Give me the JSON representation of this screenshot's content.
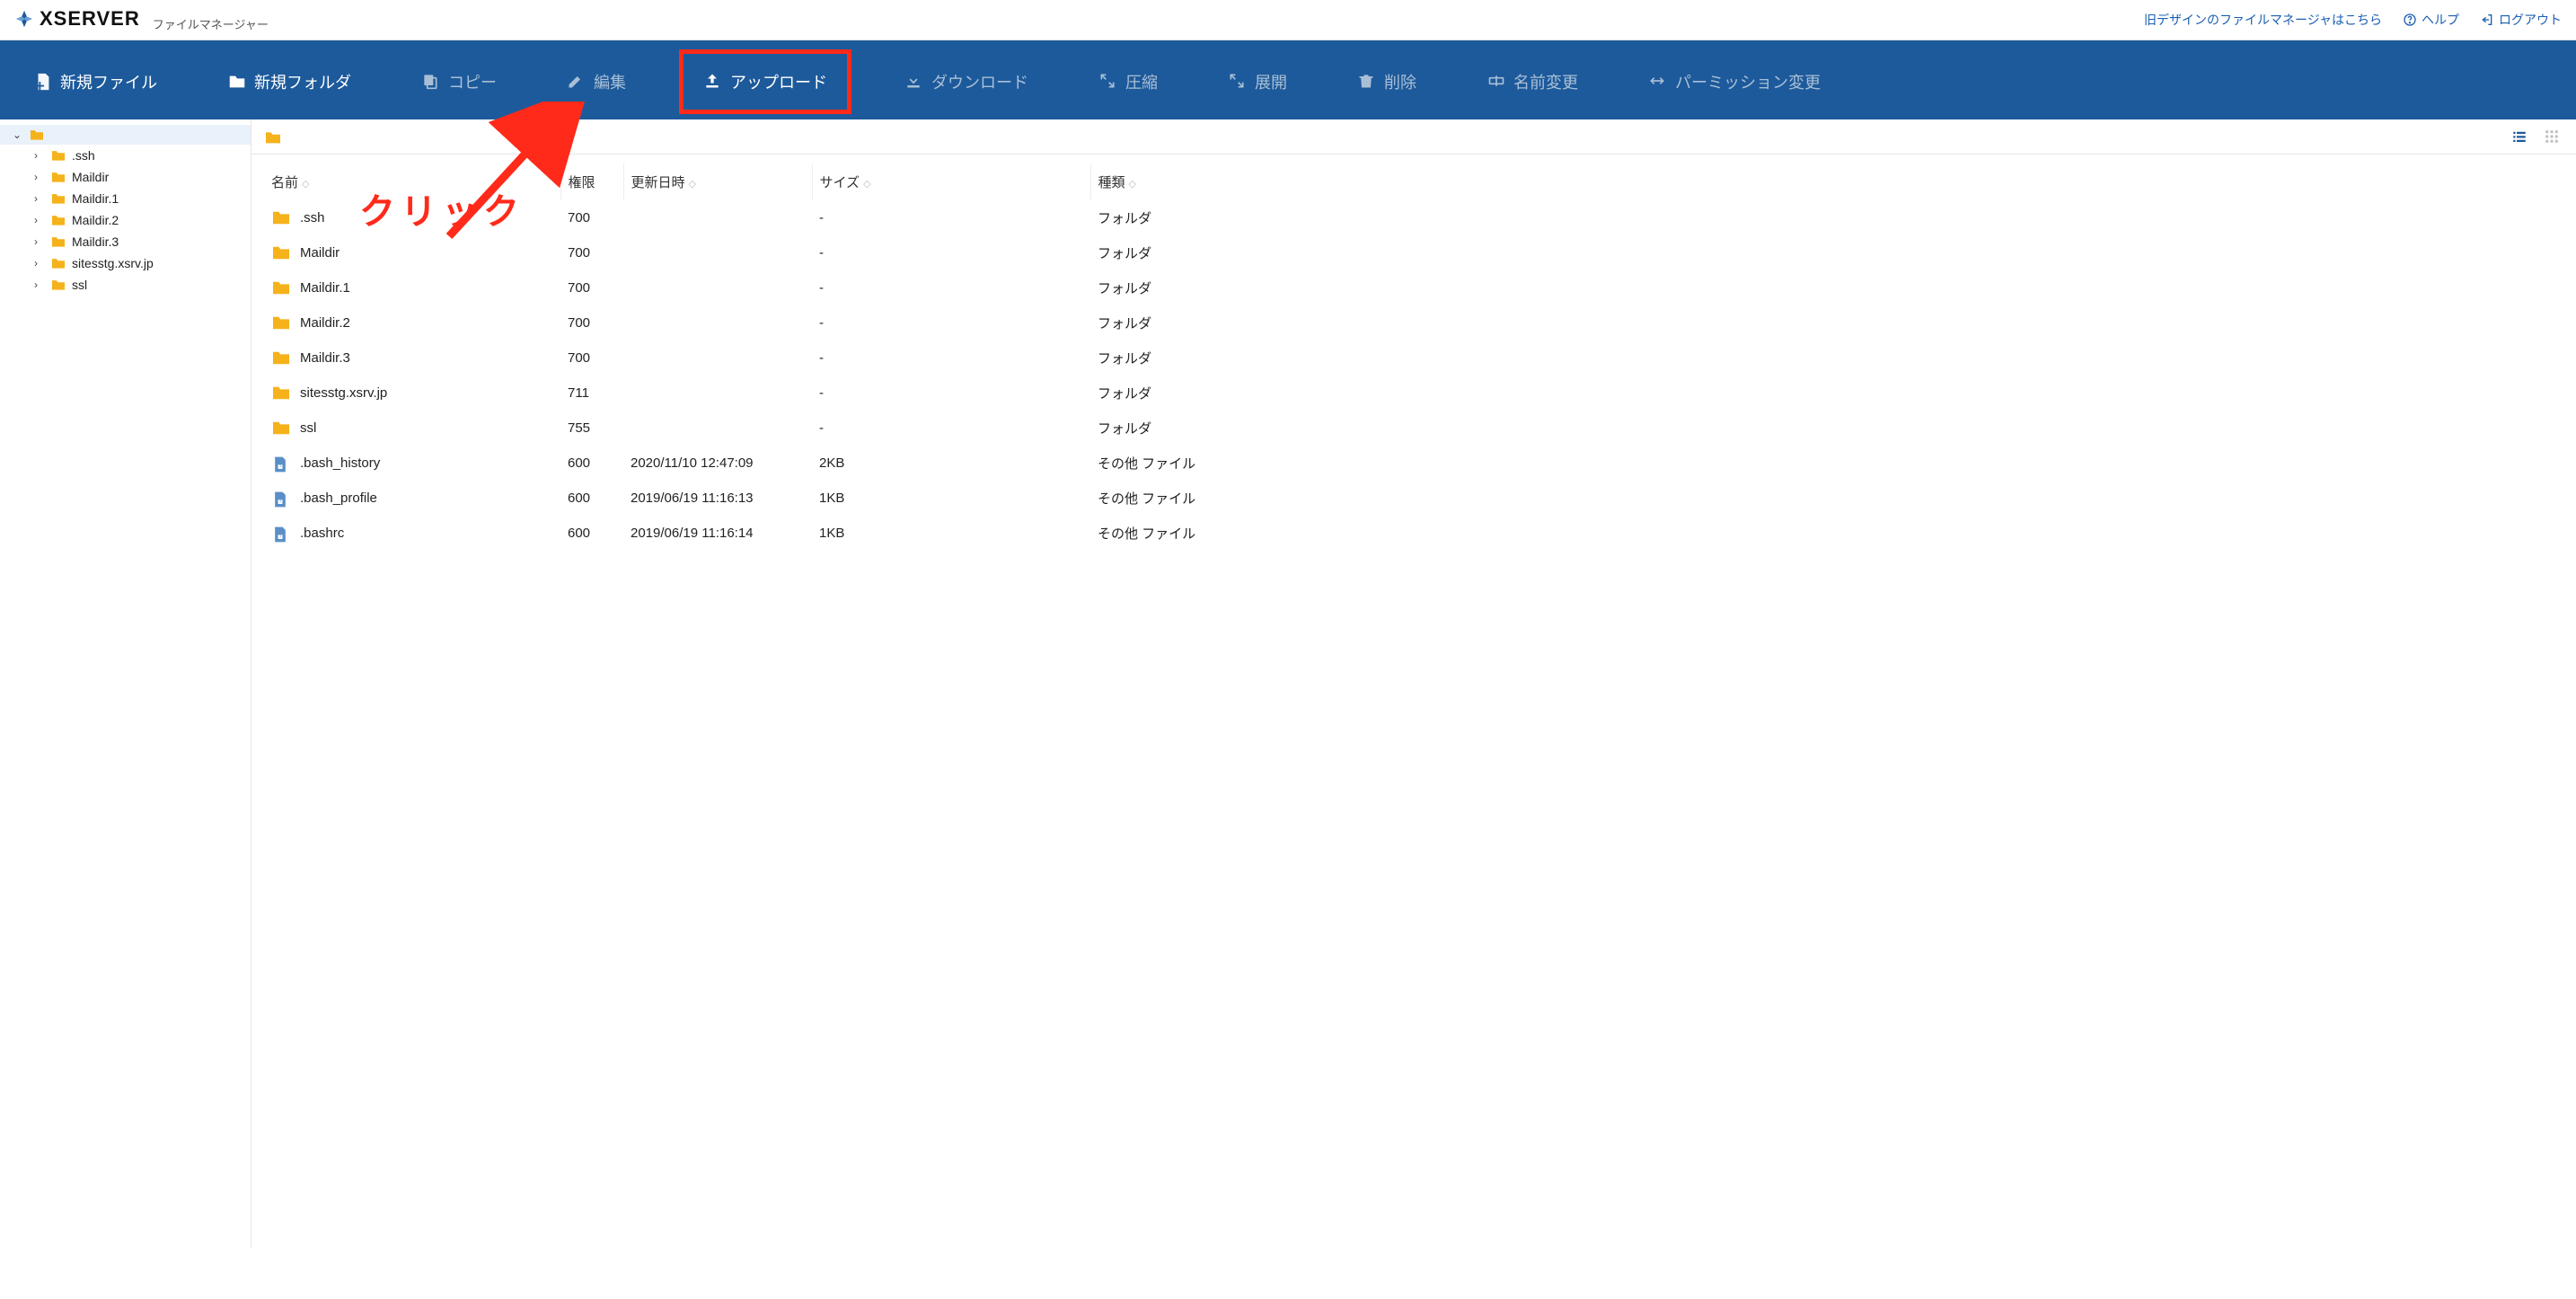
{
  "header": {
    "brand": "XSERVER",
    "subtitle": "ファイルマネージャー",
    "old_design_link": "旧デザインのファイルマネージャはこちら",
    "help": "ヘルプ",
    "logout": "ログアウト"
  },
  "toolbar": {
    "new_file": "新規ファイル",
    "new_folder": "新規フォルダ",
    "copy": "コピー",
    "edit": "編集",
    "upload": "アップロード",
    "download": "ダウンロード",
    "compress": "圧縮",
    "extract": "展開",
    "delete": "削除",
    "rename": "名前変更",
    "permission": "パーミッション変更"
  },
  "sidebar": {
    "items": [
      {
        "label": ".ssh"
      },
      {
        "label": "Maildir"
      },
      {
        "label": "Maildir.1"
      },
      {
        "label": "Maildir.2"
      },
      {
        "label": "Maildir.3"
      },
      {
        "label": "sitesstg.xsrv.jp"
      },
      {
        "label": "ssl"
      }
    ]
  },
  "table": {
    "columns": {
      "name": "名前",
      "perm": "権限",
      "date": "更新日時",
      "size": "サイズ",
      "type": "種類"
    },
    "rows": [
      {
        "icon": "folder",
        "name": ".ssh",
        "perm": "700",
        "date": "",
        "size": "-",
        "type": "フォルダ"
      },
      {
        "icon": "folder",
        "name": "Maildir",
        "perm": "700",
        "date": "",
        "size": "-",
        "type": "フォルダ"
      },
      {
        "icon": "folder",
        "name": "Maildir.1",
        "perm": "700",
        "date": "",
        "size": "-",
        "type": "フォルダ"
      },
      {
        "icon": "folder",
        "name": "Maildir.2",
        "perm": "700",
        "date": "",
        "size": "-",
        "type": "フォルダ"
      },
      {
        "icon": "folder",
        "name": "Maildir.3",
        "perm": "700",
        "date": "",
        "size": "-",
        "type": "フォルダ"
      },
      {
        "icon": "folder",
        "name": "sitesstg.xsrv.jp",
        "perm": "711",
        "date": "",
        "size": "-",
        "type": "フォルダ"
      },
      {
        "icon": "folder",
        "name": "ssl",
        "perm": "755",
        "date": "",
        "size": "-",
        "type": "フォルダ"
      },
      {
        "icon": "file",
        "name": ".bash_history",
        "perm": "600",
        "date": "2020/11/10 12:47:09",
        "size": "2KB",
        "type": "その他 ファイル"
      },
      {
        "icon": "file",
        "name": ".bash_profile",
        "perm": "600",
        "date": "2019/06/19 11:16:13",
        "size": "1KB",
        "type": "その他 ファイル"
      },
      {
        "icon": "file",
        "name": ".bashrc",
        "perm": "600",
        "date": "2019/06/19 11:16:14",
        "size": "1KB",
        "type": "その他 ファイル"
      }
    ]
  },
  "annotation": {
    "click_text": "クリック"
  }
}
